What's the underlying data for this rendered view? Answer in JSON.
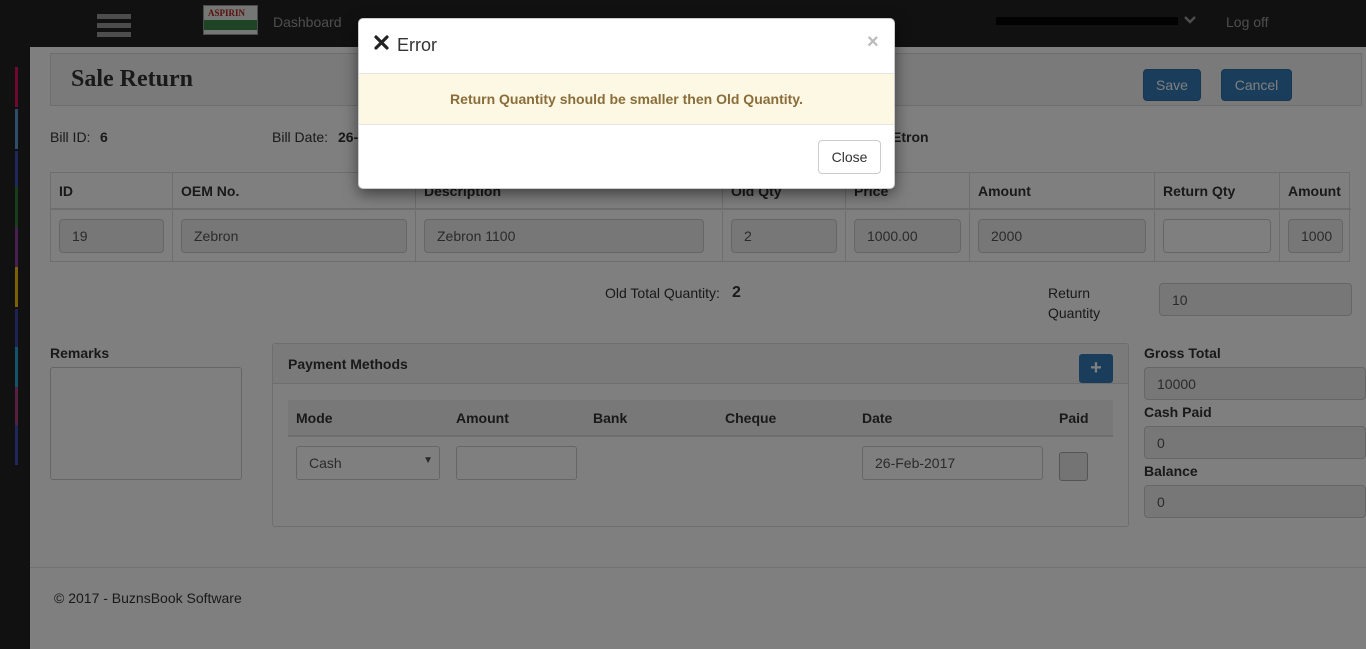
{
  "navbar": {
    "logo_text": "ASPIRIN",
    "links": [
      "Dashboard"
    ],
    "logoff": "Log off"
  },
  "sidebar": {
    "strip_colors": [
      "#e0115f",
      "#5b9bd5",
      "#3f51b5",
      "#2e7d32",
      "#8e3fa0",
      "#f4c20d",
      "#3949ab",
      "#26a6d9",
      "#b04080",
      "#3f51b5"
    ]
  },
  "page": {
    "title": "Sale Return",
    "save_label": "Save",
    "cancel_label": "Cancel"
  },
  "bill": {
    "id_label": "Bill ID:",
    "id_value": "6",
    "date_label": "Bill Date:",
    "date_value_partial": "26-",
    "customer_partial": "Etron"
  },
  "items_table": {
    "columns": [
      "ID",
      "OEM No.",
      "Description",
      "Old Qty",
      "Price",
      "Amount",
      "Return Qty",
      "Amount"
    ],
    "row": {
      "id": "19",
      "oem": "Zebron",
      "description": "Zebron 1100",
      "old_qty": "2",
      "price": "1000.00",
      "amount": "2000",
      "return_qty": "",
      "return_amount": "1000"
    }
  },
  "totals": {
    "old_total_label": "Old Total Quantity:",
    "old_total_value": "2",
    "return_qty_label_1": "Return",
    "return_qty_label_2": "Quantity",
    "return_qty_value": "10"
  },
  "remarks": {
    "label": "Remarks",
    "value": ""
  },
  "payment": {
    "title": "Payment Methods",
    "add_symbol": "+",
    "columns": [
      "Mode",
      "Amount",
      "Bank",
      "Cheque",
      "Date",
      "Paid"
    ],
    "row": {
      "mode": "Cash",
      "amount": "",
      "date": "26-Feb-2017"
    }
  },
  "summary": {
    "gross_label": "Gross Total",
    "gross_value": "10000",
    "cash_label": "Cash Paid",
    "cash_value": "0",
    "balance_label": "Balance",
    "balance_value": "0"
  },
  "footer": {
    "text": "© 2017 - BuznsBook Software"
  },
  "modal": {
    "title": "Error",
    "close_x": "×",
    "message": "Return Quantity should be smaller then Old Quantity.",
    "close_label": "Close"
  }
}
